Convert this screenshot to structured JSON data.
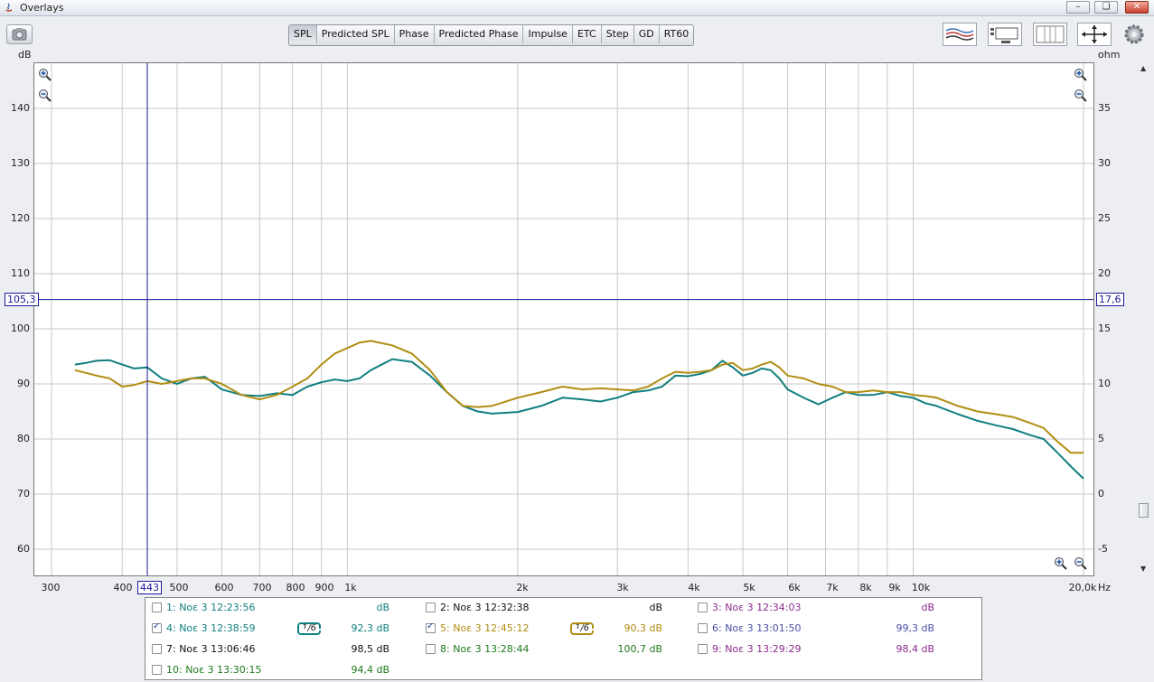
{
  "window": {
    "title": "Overlays"
  },
  "toolbar": {
    "tabs": [
      "SPL",
      "Predicted SPL",
      "Phase",
      "Predicted Phase",
      "Impulse",
      "ETC",
      "Step",
      "GD",
      "RT60"
    ],
    "active_tab": "SPL"
  },
  "axes": {
    "left_unit": "dB",
    "right_unit": "ohm",
    "x_unit": "Hz",
    "left_ticks": [
      "140",
      "130",
      "120",
      "110",
      "100",
      "90",
      "80",
      "70",
      "60"
    ],
    "right_ticks": [
      "35",
      "30",
      "25",
      "20",
      "15",
      "10",
      "5",
      "0",
      "-5"
    ],
    "x_ticks": [
      "300",
      "400",
      "500",
      "600",
      "700",
      "800",
      "900",
      "1k",
      "2k",
      "3k",
      "4k",
      "5k",
      "6k",
      "7k",
      "8k",
      "9k",
      "10k",
      "20,0k"
    ]
  },
  "cursor": {
    "x_label": "443",
    "y_left_label": "105,3",
    "y_right_label": "17,6"
  },
  "colors": {
    "teal": "#127f7f",
    "gold": "#b08d12",
    "cursor": "#1a1a9a",
    "grid": "#c9c9c9"
  },
  "chart_data": {
    "type": "line",
    "x_scale": "log",
    "xlim": [
      280,
      20000
    ],
    "ylim": [
      55,
      148
    ],
    "y2lim": [
      -7.5,
      37
    ],
    "series": [
      {
        "name": "4: Νοε 3 12:38:59",
        "color": "#127f7f",
        "x": [
          330,
          345,
          360,
          380,
          400,
          420,
          443,
          470,
          500,
          530,
          560,
          600,
          650,
          700,
          750,
          800,
          850,
          900,
          950,
          1000,
          1050,
          1100,
          1200,
          1300,
          1400,
          1500,
          1600,
          1700,
          1800,
          2000,
          2200,
          2400,
          2600,
          2800,
          3000,
          3200,
          3400,
          3600,
          3800,
          4000,
          4200,
          4400,
          4600,
          4800,
          5000,
          5200,
          5400,
          5600,
          5800,
          6000,
          6400,
          6800,
          7200,
          7600,
          8000,
          8500,
          9000,
          9500,
          10000,
          10500,
          11000,
          12000,
          13000,
          14000,
          15000,
          16000,
          17000,
          18000,
          19000,
          20000
        ],
        "values": [
          93.5,
          93.8,
          94.2,
          94.3,
          93.5,
          92.8,
          93.0,
          91.0,
          90.0,
          91.0,
          91.3,
          89.0,
          88.0,
          87.8,
          88.3,
          88.0,
          89.5,
          90.3,
          90.8,
          90.5,
          91.0,
          92.5,
          94.5,
          94.0,
          91.5,
          88.5,
          86.0,
          85.0,
          84.6,
          84.9,
          86.0,
          87.5,
          87.2,
          86.8,
          87.5,
          88.5,
          88.8,
          89.5,
          91.5,
          91.4,
          91.8,
          92.5,
          94.2,
          93.0,
          91.5,
          92.0,
          92.8,
          92.5,
          91.0,
          89.0,
          87.5,
          86.3,
          87.5,
          88.5,
          88.0,
          88.0,
          88.5,
          87.8,
          87.5,
          86.5,
          86.0,
          84.5,
          83.3,
          82.5,
          81.8,
          80.8,
          80.0,
          77.5,
          75.0,
          72.8
        ]
      },
      {
        "name": "5: Νοε 3 12:45:12",
        "color": "#b08d12",
        "x": [
          330,
          345,
          360,
          380,
          400,
          420,
          443,
          470,
          500,
          530,
          560,
          600,
          650,
          700,
          750,
          800,
          850,
          900,
          950,
          1000,
          1050,
          1100,
          1200,
          1300,
          1400,
          1500,
          1600,
          1700,
          1800,
          2000,
          2200,
          2400,
          2600,
          2800,
          3000,
          3200,
          3400,
          3600,
          3800,
          4000,
          4200,
          4400,
          4600,
          4800,
          5000,
          5200,
          5400,
          5600,
          5800,
          6000,
          6400,
          6800,
          7200,
          7600,
          8000,
          8500,
          9000,
          9500,
          10000,
          10500,
          11000,
          12000,
          13000,
          14000,
          15000,
          16000,
          17000,
          18000,
          19000,
          20000
        ],
        "values": [
          92.5,
          92.0,
          91.5,
          91.0,
          89.5,
          89.8,
          90.5,
          90.0,
          90.5,
          91.0,
          91.0,
          90.0,
          88.0,
          87.2,
          88.0,
          89.5,
          91.0,
          93.5,
          95.5,
          96.5,
          97.5,
          97.8,
          97.0,
          95.5,
          92.5,
          88.5,
          86.0,
          85.8,
          86.0,
          87.5,
          88.5,
          89.5,
          89.0,
          89.2,
          89.0,
          88.8,
          89.5,
          91.0,
          92.2,
          92.0,
          92.2,
          92.5,
          93.5,
          93.8,
          92.5,
          92.8,
          93.5,
          94.0,
          93.0,
          91.5,
          91.0,
          90.0,
          89.5,
          88.5,
          88.5,
          88.8,
          88.5,
          88.5,
          88.0,
          87.8,
          87.5,
          86.0,
          85.0,
          84.5,
          84.0,
          83.0,
          82.0,
          79.5,
          77.5,
          77.5
        ]
      }
    ]
  },
  "legend": {
    "entries": [
      {
        "label": "1: Νοε 3 12:23:56",
        "value": "dB",
        "checked": false,
        "color": "#127f7f",
        "smoothing": ""
      },
      {
        "label": "2: Νοε 3 12:32:38",
        "value": "dB",
        "checked": false,
        "color": "#111111",
        "smoothing": ""
      },
      {
        "label": "3: Νοε 3 12:34:03",
        "value": "dB",
        "checked": false,
        "color": "#8a2b8a",
        "smoothing": ""
      },
      {
        "label": "4: Νοε 3 12:38:59",
        "value": "92,3 dB",
        "checked": true,
        "color": "#127f7f",
        "smoothing": "1/6"
      },
      {
        "label": "5: Νοε 3 12:45:12",
        "value": "90,3 dB",
        "checked": true,
        "color": "#b08d12",
        "smoothing": "1/6"
      },
      {
        "label": "6: Νοε 3 13:01:50",
        "value": "99,3 dB",
        "checked": false,
        "color": "#4a4fa5",
        "smoothing": ""
      },
      {
        "label": "7: Νοε 3 13:06:46",
        "value": "98,5 dB",
        "checked": false,
        "color": "#111111",
        "smoothing": ""
      },
      {
        "label": "8: Νοε 3 13:28:44",
        "value": "100,7 dB",
        "checked": false,
        "color": "#1f7a1f",
        "smoothing": ""
      },
      {
        "label": "9: Νοε 3 13:29:29",
        "value": "98,4 dB",
        "checked": false,
        "color": "#8a2b8a",
        "smoothing": ""
      },
      {
        "label": "10: Νοε 3 13:30:15",
        "value": "94,4 dB",
        "checked": false,
        "color": "#1f7a1f",
        "smoothing": ""
      }
    ]
  }
}
